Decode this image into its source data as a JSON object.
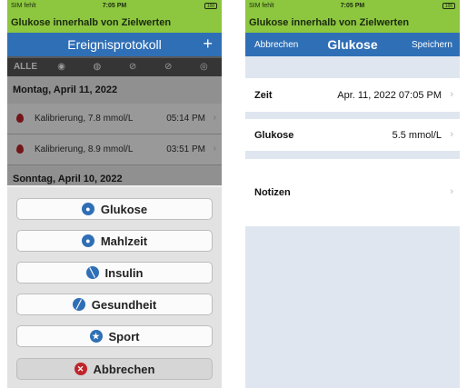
{
  "status": {
    "carrier": "SIM fehlt",
    "time": "7:05 PM",
    "battery": "100"
  },
  "banner": "Glukose innerhalb von Zielwerten",
  "log": {
    "title": "Ereignisprotokoll",
    "add": "+",
    "filters": {
      "all": "ALLE"
    },
    "days": [
      {
        "label": "Montag, April 11, 2022",
        "entries": [
          {
            "text": "Kalibrierung, 7.8 mmol/L",
            "time": "05:14 PM"
          },
          {
            "text": "Kalibrierung, 8.9 mmol/L",
            "time": "03:51 PM"
          }
        ]
      },
      {
        "label": "Sonntag, April 10, 2022"
      }
    ]
  },
  "sheet": {
    "options": [
      {
        "label": "Glukose",
        "icon": "drop-icon"
      },
      {
        "label": "Mahlzeit",
        "icon": "apple-icon"
      },
      {
        "label": "Insulin",
        "icon": "syringe-icon"
      },
      {
        "label": "Gesundheit",
        "icon": "bandage-icon"
      },
      {
        "label": "Sport",
        "icon": "runner-icon"
      }
    ],
    "cancel": "Abbrechen"
  },
  "form": {
    "cancel": "Abbrechen",
    "title": "Glukose",
    "save": "Speichern",
    "fields": {
      "zeit_label": "Zeit",
      "zeit_value": "Apr. 11, 2022 07:05 PM",
      "glukose_label": "Glukose",
      "glukose_value": "5.5 mmol/L",
      "notizen_label": "Notizen"
    }
  },
  "colors": {
    "green": "#8dc63f",
    "blue": "#2f6fb6",
    "red": "#c0242b"
  }
}
